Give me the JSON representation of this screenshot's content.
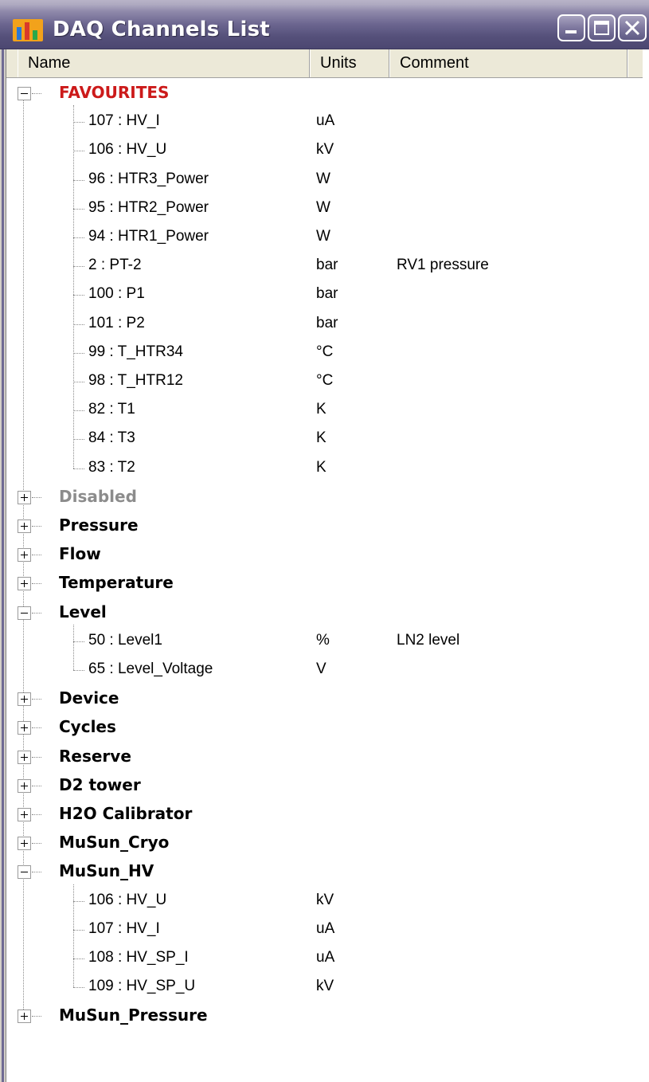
{
  "window": {
    "title": "DAQ Channels List",
    "accent_color": "#55507a",
    "favourites_color": "#cc1a1a",
    "disabled_color": "#8c8c8c"
  },
  "columns": {
    "name": "Name",
    "units": "Units",
    "comment": "Comment"
  },
  "groups": [
    {
      "label": "FAVOURITES",
      "expanded": true,
      "style": "fav",
      "channels": [
        {
          "name": "107 : HV_I",
          "units": "uA",
          "comment": ""
        },
        {
          "name": "106 : HV_U",
          "units": "kV",
          "comment": ""
        },
        {
          "name": "96 : HTR3_Power",
          "units": "W",
          "comment": ""
        },
        {
          "name": "95 : HTR2_Power",
          "units": "W",
          "comment": ""
        },
        {
          "name": "94 : HTR1_Power",
          "units": "W",
          "comment": ""
        },
        {
          "name": "2 : PT-2",
          "units": "bar",
          "comment": "RV1 pressure"
        },
        {
          "name": "100 : P1",
          "units": "bar",
          "comment": ""
        },
        {
          "name": "101 : P2",
          "units": "bar",
          "comment": ""
        },
        {
          "name": "99 : T_HTR34",
          "units": "°C",
          "comment": ""
        },
        {
          "name": "98 : T_HTR12",
          "units": "°C",
          "comment": ""
        },
        {
          "name": "82 : T1",
          "units": "K",
          "comment": ""
        },
        {
          "name": "84 : T3",
          "units": "K",
          "comment": ""
        },
        {
          "name": "83 : T2",
          "units": "K",
          "comment": ""
        }
      ]
    },
    {
      "label": "Disabled",
      "expanded": false,
      "style": "dis",
      "channels": []
    },
    {
      "label": "Pressure",
      "expanded": false,
      "style": "",
      "channels": []
    },
    {
      "label": "Flow",
      "expanded": false,
      "style": "",
      "channels": []
    },
    {
      "label": "Temperature",
      "expanded": false,
      "style": "",
      "channels": []
    },
    {
      "label": "Level",
      "expanded": true,
      "style": "",
      "channels": [
        {
          "name": "50 : Level1",
          "units": "%",
          "comment": "LN2 level"
        },
        {
          "name": "65 : Level_Voltage",
          "units": "V",
          "comment": ""
        }
      ]
    },
    {
      "label": "Device",
      "expanded": false,
      "style": "",
      "channels": []
    },
    {
      "label": "Cycles",
      "expanded": false,
      "style": "",
      "channels": []
    },
    {
      "label": "Reserve",
      "expanded": false,
      "style": "",
      "channels": []
    },
    {
      "label": "D2 tower",
      "expanded": false,
      "style": "",
      "channels": []
    },
    {
      "label": "H2O Calibrator",
      "expanded": false,
      "style": "",
      "channels": []
    },
    {
      "label": "MuSun_Cryo",
      "expanded": false,
      "style": "",
      "channels": []
    },
    {
      "label": "MuSun_HV",
      "expanded": true,
      "style": "",
      "channels": [
        {
          "name": "106 : HV_U",
          "units": "kV",
          "comment": ""
        },
        {
          "name": "107 : HV_I",
          "units": "uA",
          "comment": ""
        },
        {
          "name": "108 : HV_SP_I",
          "units": "uA",
          "comment": ""
        },
        {
          "name": "109 : HV_SP_U",
          "units": "kV",
          "comment": ""
        }
      ]
    },
    {
      "label": "MuSun_Pressure",
      "expanded": false,
      "style": "",
      "channels": []
    }
  ]
}
